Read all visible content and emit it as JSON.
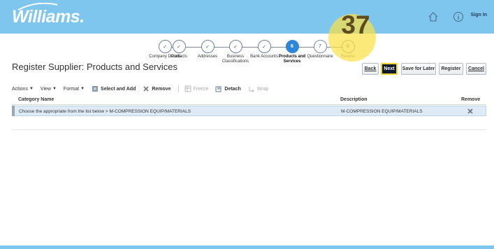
{
  "header": {
    "logo_text": "Williams.",
    "home_icon": "home-icon",
    "info_icon": "info-icon",
    "signin_label": "Sign In",
    "bg_color": "#7fc6ee"
  },
  "train": {
    "steps": [
      {
        "mark": "✓",
        "label": "Company Details",
        "state": "done"
      },
      {
        "mark": "✓",
        "label": "Contacts",
        "state": "done"
      },
      {
        "mark": "✓",
        "label": "Addresses",
        "state": "done"
      },
      {
        "mark": "✓",
        "label": "Business Classifications",
        "state": "done"
      },
      {
        "mark": "✓",
        "label": "Bank Accounts",
        "state": "done"
      },
      {
        "mark": "6",
        "label": "Products and Services",
        "state": "current"
      },
      {
        "mark": "7",
        "label": "Questionnaire",
        "state": "future"
      },
      {
        "mark": "8",
        "label": "Review",
        "state": "future"
      }
    ]
  },
  "badge": {
    "number": "37"
  },
  "page": {
    "title": "Register Supplier: Products and Services"
  },
  "buttons": {
    "back": "Back",
    "next": "Next",
    "save_for_later": "Save for Later",
    "register": "Register",
    "cancel": "Cancel"
  },
  "toolbar": {
    "actions": "Actions",
    "view": "View",
    "format": "Format",
    "select_and_add": "Select and Add",
    "remove": "Remove",
    "freeze": "Freeze",
    "detach": "Detach",
    "wrap": "Wrap"
  },
  "table": {
    "columns": [
      "Category Name",
      "Description",
      "Remove"
    ],
    "rows": [
      {
        "category": "Choose the appropriate from the list below > M-COMPRESSION EQUIP/MATERIALS",
        "description": "M-COMPRESSION EQUIP/MATERIALS",
        "remove_icon": "remove-x-icon"
      }
    ]
  }
}
